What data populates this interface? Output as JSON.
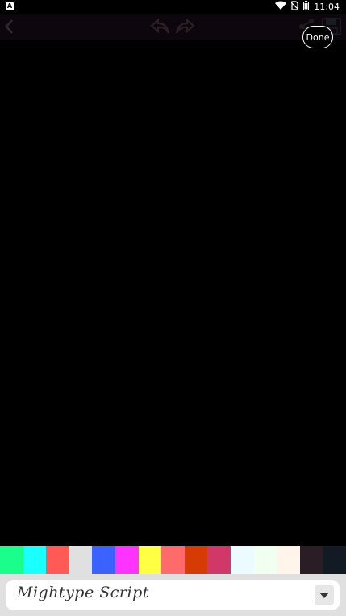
{
  "status_bar": {
    "time": "11:04",
    "notification_glyph": "A",
    "icons": [
      "wifi-icon",
      "no-sim-icon",
      "battery-icon"
    ]
  },
  "toolbar": {
    "icons": [
      "back-icon",
      "undo-icon",
      "redo-icon",
      "share-icon",
      "save-icon"
    ]
  },
  "done_button": {
    "label": "Done"
  },
  "palette": {
    "colors": [
      "#1aff8c",
      "#1affff",
      "#ff5a55",
      "#e0e0e0",
      "#3b62ff",
      "#ff33ff",
      "#ffff44",
      "#ff6a6a",
      "#d63a05",
      "#cf3868",
      "#ecfbff",
      "#f0fff0",
      "#fff5ea",
      "#2b1d24",
      "#121a24"
    ]
  },
  "font_selector": {
    "selected": "Mightype Script"
  }
}
